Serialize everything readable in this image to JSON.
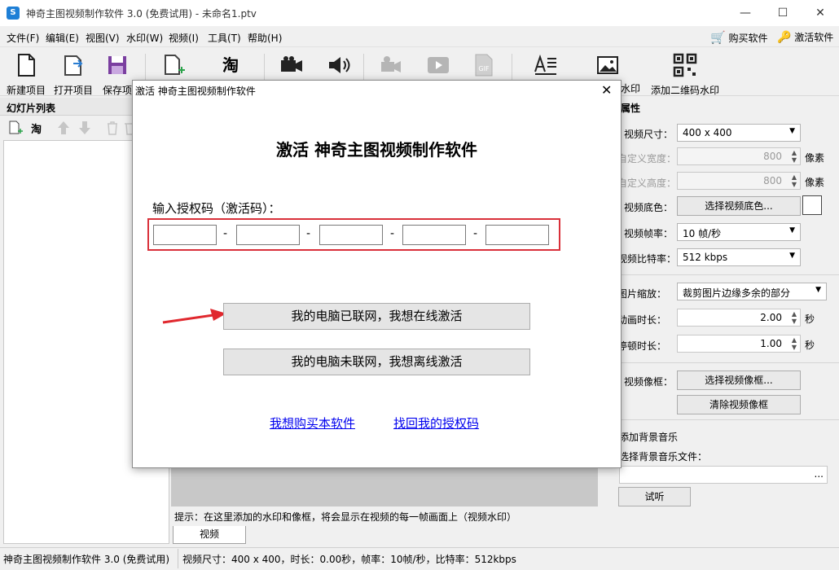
{
  "window": {
    "app_icon": "S",
    "title": "神奇主图视频制作软件 3.0 (免费试用) - 未命名1.ptv",
    "controls": {
      "minimize": "—",
      "maximize": "☐",
      "close": "✕"
    }
  },
  "menu": {
    "items": [
      "文件(F)",
      "编辑(E)",
      "视图(V)",
      "水印(W)",
      "视频(I)",
      "工具(T)",
      "帮助(H)"
    ],
    "buy_label": "购买软件",
    "activate_label": "激活软件"
  },
  "toolbar": {
    "new_project": "新建项目",
    "open_project": "打开项目",
    "save_project": "保存项",
    "taobao_label": "淘",
    "text_watermark": "水印",
    "qr_watermark": "添加二维码水印"
  },
  "left_panel": {
    "header": "幻灯片列表",
    "taobao_label": "淘"
  },
  "center": {
    "hint": "提示：在这里添加的水印和像框，将会显示在视频的每一帧画面上（视频水印）",
    "tab_label": "视频"
  },
  "properties": {
    "header": "属性",
    "video_size_label": "视频尺寸：",
    "video_size_value": "400 x 400",
    "custom_width_label": "自定义宽度：",
    "custom_width_value": "800",
    "custom_height_label": "自定义高度：",
    "custom_height_value": "800",
    "unit_px": "像素",
    "bg_color_label": "视频底色：",
    "bg_color_button": "选择视频底色...",
    "frame_rate_label": "视频帧率：",
    "frame_rate_value": "10 帧/秒",
    "bitrate_label": "视频比特率：",
    "bitrate_value": "512 kbps",
    "scale_label": "图片缩放：",
    "scale_value": "裁剪图片边缘多余的部分",
    "anim_label": "动画时长：",
    "anim_value": "2.00",
    "pause_label": "停顿时长：",
    "pause_value": "1.00",
    "unit_sec": "秒",
    "frame_label": "视频像框：",
    "frame_select_button": "选择视频像框...",
    "frame_clear_button": "清除视频像框",
    "bgm_label": "添加背景音乐",
    "bgm_file_label": "选择背景音乐文件：",
    "bgm_browse": "...",
    "listen_button": "试听",
    "color_swatch": "#ffffff"
  },
  "status": {
    "left": "神奇主图视频制作软件 3.0 (免费试用)",
    "right": "视频尺寸：400 x 400，时长：0.00秒，帧率：10帧/秒，比特率：512kbps"
  },
  "dialog": {
    "title": "激活 神奇主图视频制作软件",
    "close": "✕",
    "heading": "激活 神奇主图视频制作软件",
    "code_label": "输入授权码（激活码）：",
    "code_separator": "-",
    "code_values": [
      "",
      "",
      "",
      "",
      ""
    ],
    "online_button": "我的电脑已联网，我想在线激活",
    "offline_button": "我的电脑未联网，我想离线激活",
    "buy_link": "我想购买本软件",
    "recover_link": "找回我的授权码",
    "highlight_color": "#d9303a"
  }
}
